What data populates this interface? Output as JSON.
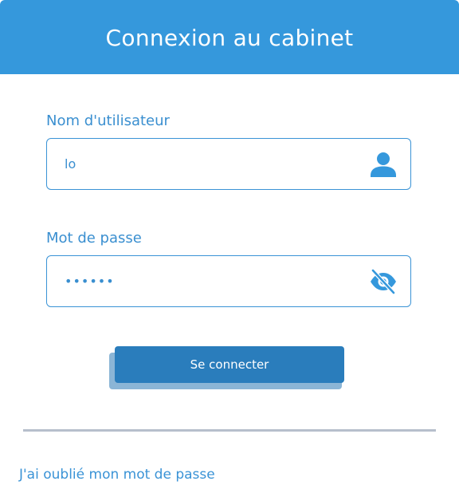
{
  "header": {
    "title": "Connexion au cabinet"
  },
  "form": {
    "username": {
      "label": "Nom d'utilisateur",
      "value": "lo",
      "icon": "user-icon"
    },
    "password": {
      "label": "Mot de passe",
      "value": "azerty",
      "icon": "eye-slash-icon"
    },
    "submit_label": "Se connecter"
  },
  "footer": {
    "forgot_password": "J'ai oublié mon mot de passe"
  },
  "colors": {
    "primary": "#3598dc",
    "button": "#2a7dbc",
    "button_shadow": "#8bb5d6",
    "divider": "#b7bfcc"
  }
}
